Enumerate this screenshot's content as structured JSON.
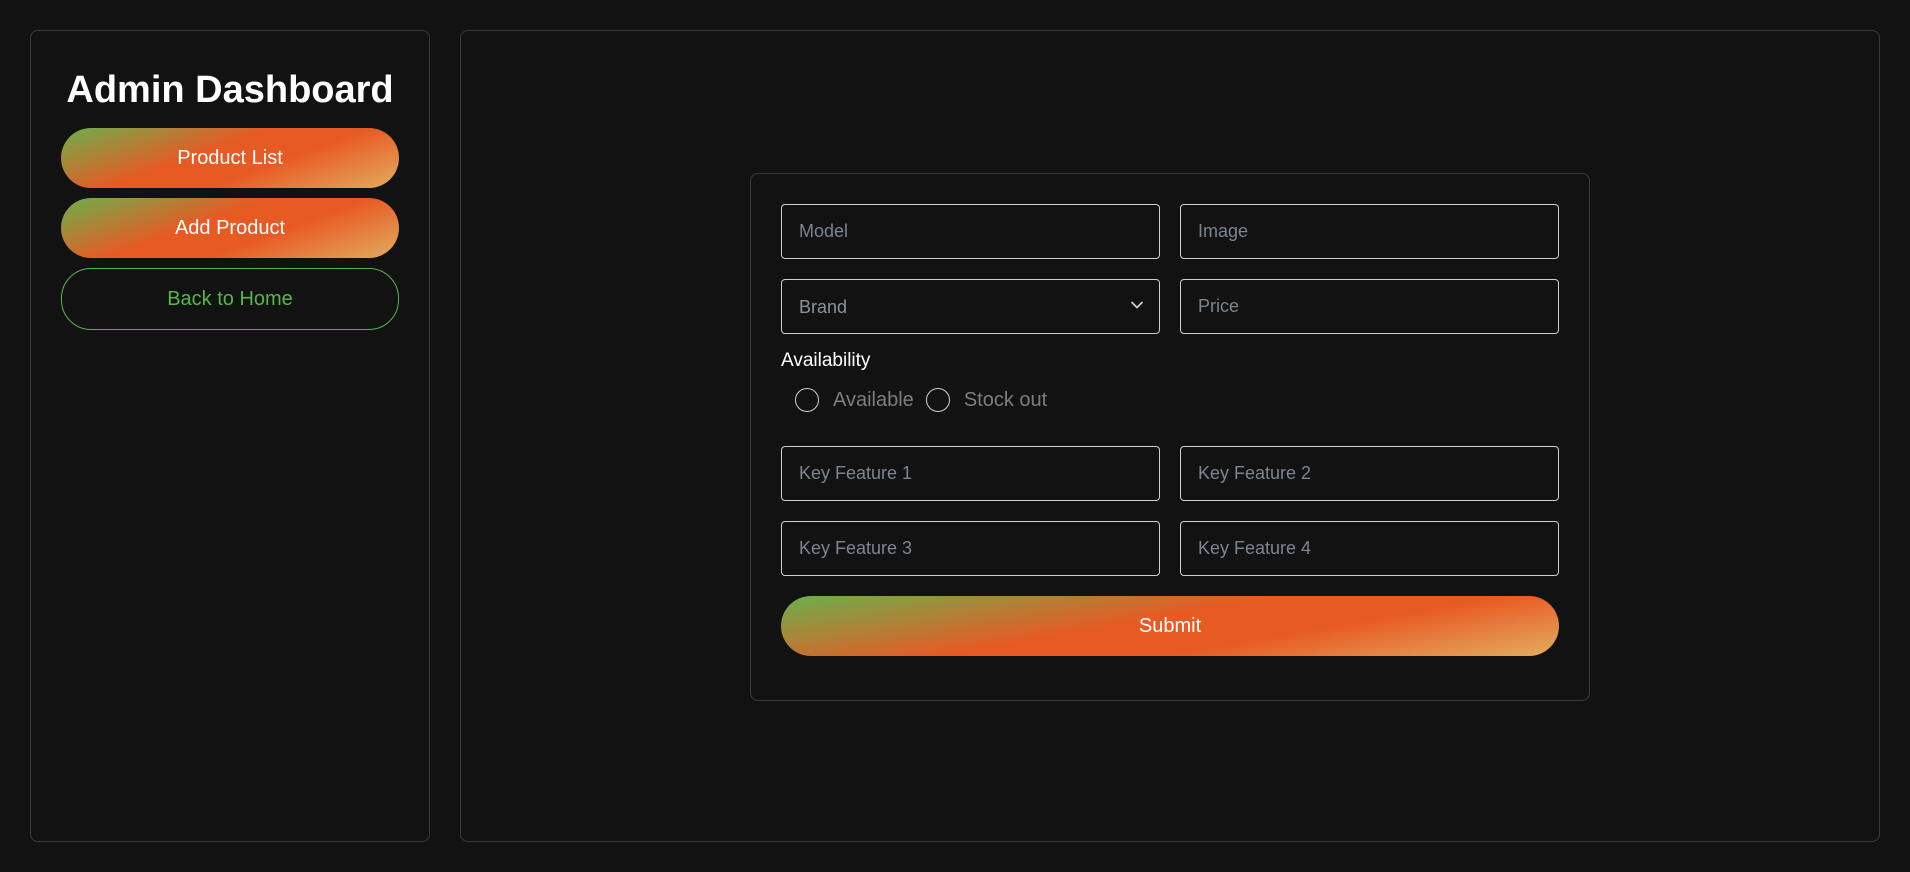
{
  "sidebar": {
    "title": "Admin Dashboard",
    "items": [
      {
        "label": "Product List"
      },
      {
        "label": "Add Product"
      },
      {
        "label": "Back to Home"
      }
    ]
  },
  "form": {
    "model": {
      "placeholder": "Model",
      "value": ""
    },
    "image": {
      "placeholder": "Image",
      "value": ""
    },
    "brand": {
      "selected": "Brand"
    },
    "price": {
      "placeholder": "Price",
      "value": ""
    },
    "availability": {
      "label": "Availability",
      "options": [
        {
          "label": "Available",
          "checked": false
        },
        {
          "label": "Stock out",
          "checked": false
        }
      ]
    },
    "key_feature_1": {
      "placeholder": "Key Feature 1",
      "value": ""
    },
    "key_feature_2": {
      "placeholder": "Key Feature 2",
      "value": ""
    },
    "key_feature_3": {
      "placeholder": "Key Feature 3",
      "value": ""
    },
    "key_feature_4": {
      "placeholder": "Key Feature 4",
      "value": ""
    },
    "submit_label": "Submit"
  },
  "colors": {
    "background": "#121212",
    "border": "#3a3a3a",
    "accent_green": "#54b847",
    "accent_orange": "#e85a24",
    "accent_gold": "#e2ad5e"
  },
  "icons": {
    "brand_dropdown": "chevron-down-icon"
  }
}
